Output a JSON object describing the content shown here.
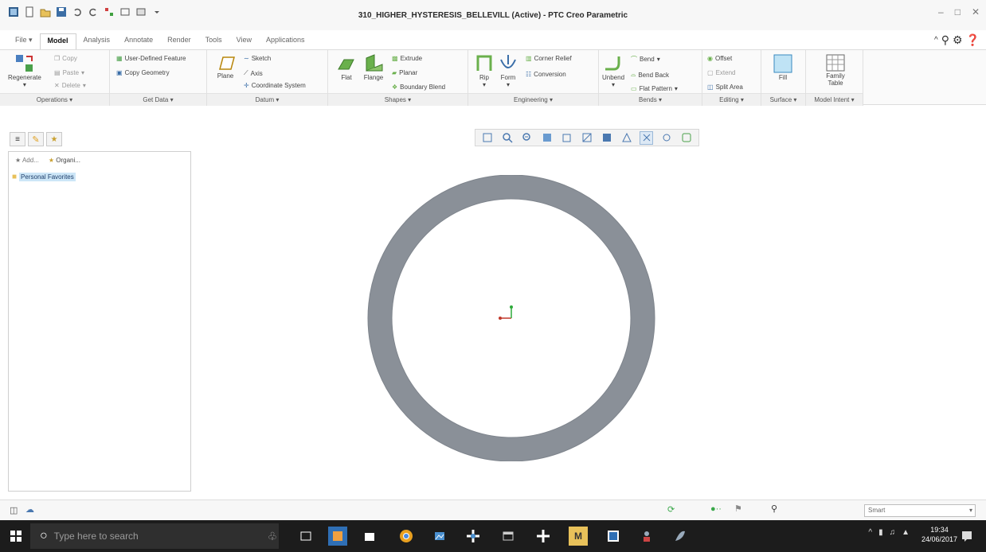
{
  "window": {
    "title": "310_HIGHER_HYSTERESIS_BELLEVILL (Active) - PTC Creo Parametric"
  },
  "tabs": [
    {
      "label": "File"
    },
    {
      "label": "Model",
      "active": true
    },
    {
      "label": "Analysis"
    },
    {
      "label": "Annotate"
    },
    {
      "label": "Render"
    },
    {
      "label": "Tools"
    },
    {
      "label": "View"
    },
    {
      "label": "Applications"
    }
  ],
  "ribbon": {
    "operations": {
      "label": "Operations",
      "regenerate": "Regenerate",
      "copy": "Copy",
      "paste": "Paste",
      "delete": "Delete"
    },
    "get_data": {
      "label": "Get Data",
      "udf": "User-Defined Feature",
      "copy_geometry": "Copy Geometry"
    },
    "datum": {
      "label": "Datum",
      "plane": "Plane",
      "sketch": "Sketch",
      "axis": "Axis",
      "coord_sys": "Coordinate System"
    },
    "shapes": {
      "label": "Shapes",
      "flat": "Flat",
      "flange": "Flange",
      "extrude": "Extrude",
      "planar": "Planar",
      "boundary_blend": "Boundary Blend"
    },
    "engineering": {
      "label": "Engineering",
      "rip": "Rip",
      "form": "Form",
      "corner_relief": "Corner Relief",
      "conversion": "Conversion"
    },
    "bends": {
      "label": "Bends",
      "unbend": "Unbend",
      "bend": "Bend",
      "bend_back": "Bend Back",
      "flat_pattern": "Flat Pattern"
    },
    "editing": {
      "label": "Editing",
      "offset": "Offset",
      "extend": "Extend",
      "split_area": "Split Area"
    },
    "surface": {
      "label": "Surface",
      "fill": "Fill"
    },
    "model_intent": {
      "label": "Model Intent",
      "family_table": "Family Table"
    }
  },
  "navigator": {
    "add_label": "Add...",
    "organize_label": "Organi...",
    "favorites_label": "Personal Favorites"
  },
  "statusbar": {
    "selection_filter": "Smart"
  },
  "taskbar": {
    "search_placeholder": "Type here to search",
    "time": "19:34",
    "date": "24/06/2017"
  },
  "colors": {
    "ring_fill": "#8a9098",
    "accent_green": "#3aa84a",
    "taskbar_bg": "#1c1c1c"
  }
}
